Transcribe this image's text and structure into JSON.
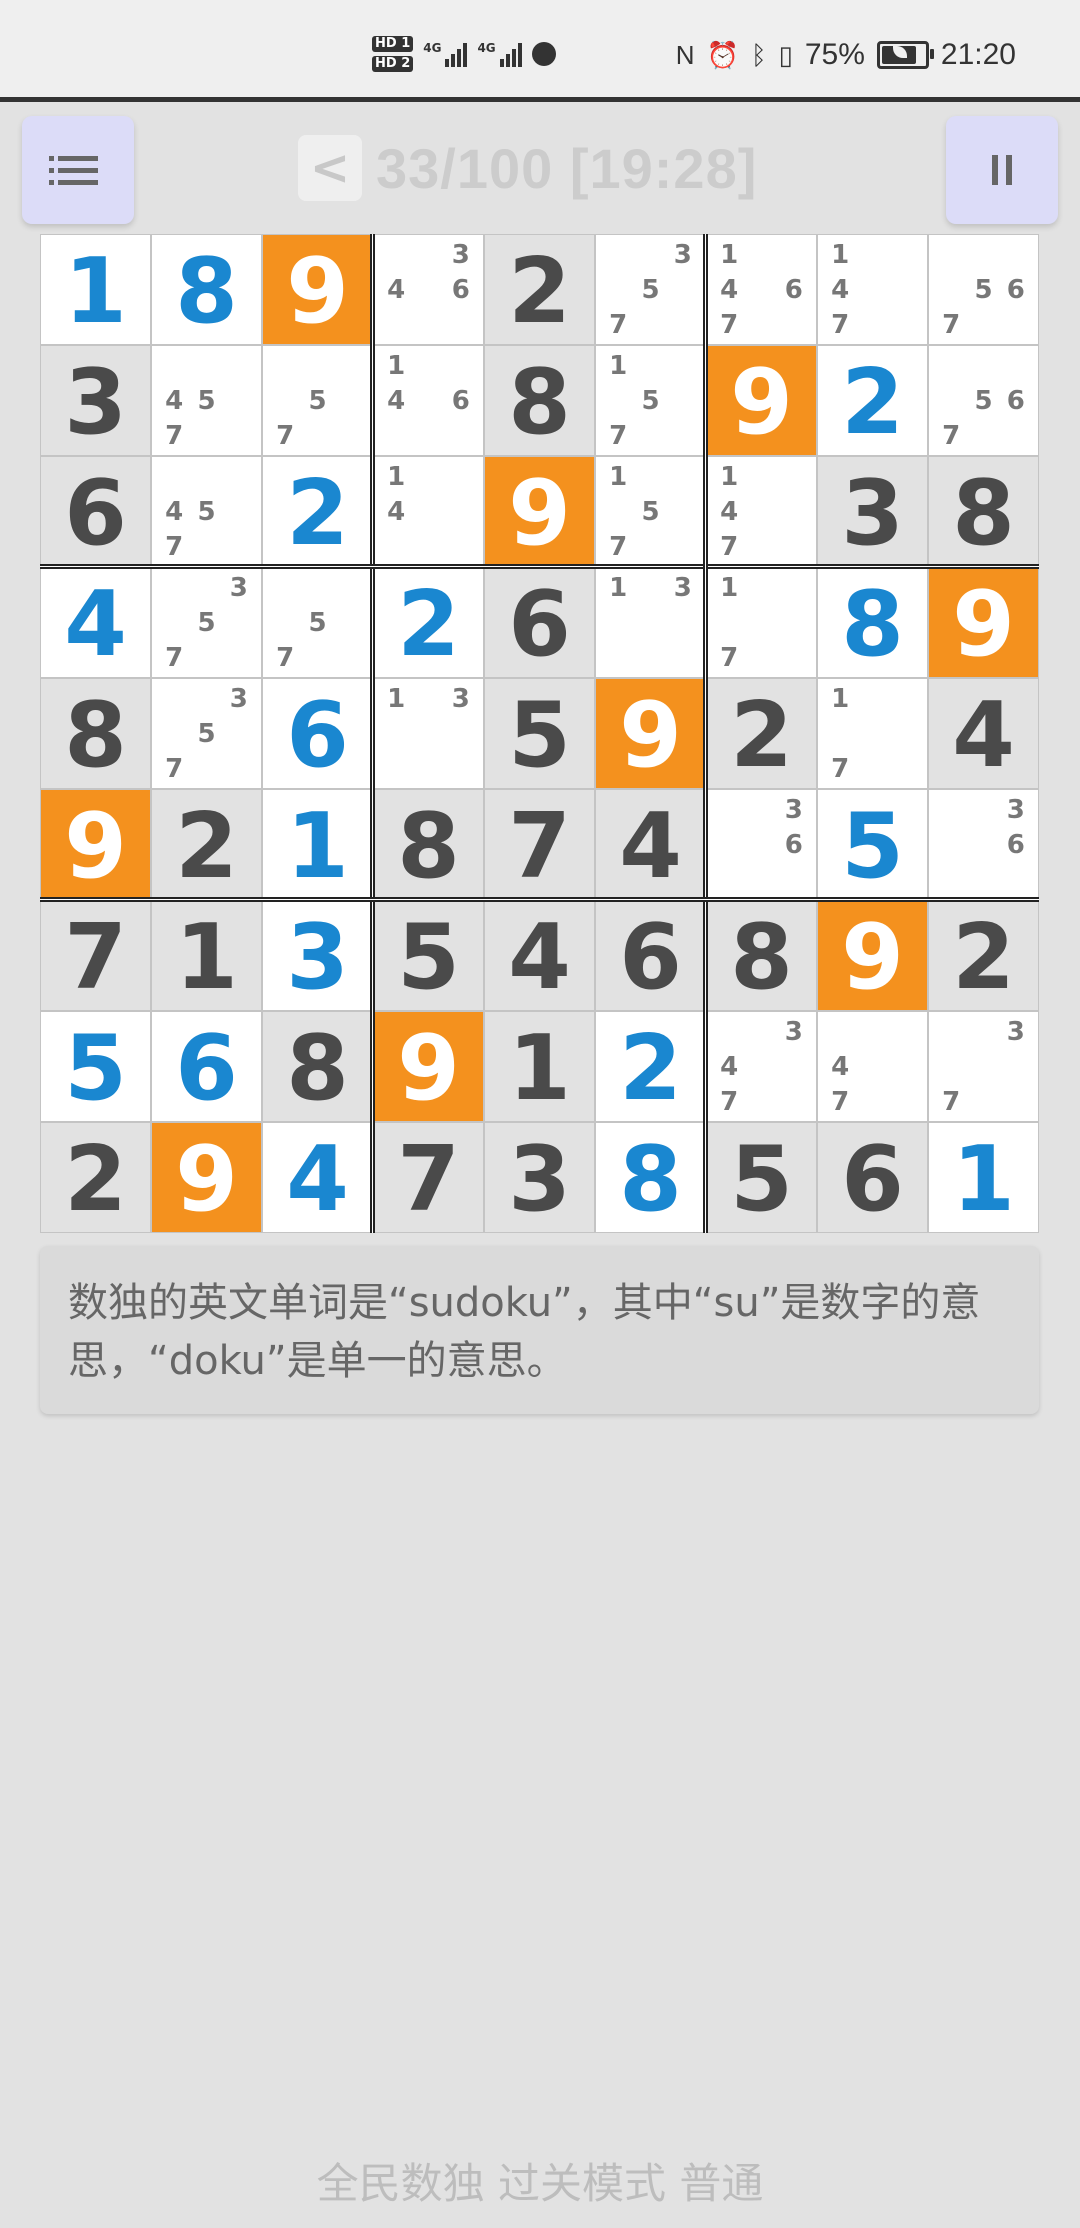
{
  "status_bar": {
    "hd1": "HD 1",
    "hd2": "HD 2",
    "net1": "4G",
    "net2": "4G",
    "battery_percent": "75%",
    "time": "21:20",
    "icons": [
      "nfc-icon",
      "alarm-icon",
      "bluetooth-icon",
      "vibrate-icon",
      "battery-icon"
    ]
  },
  "header": {
    "menu_icon": "list-icon",
    "back_label": "<",
    "progress": "33/100 [19:28]",
    "pause_icon": "pause-icon"
  },
  "board": {
    "highlight_digit": 9,
    "colors": {
      "given": "#4a4a4a",
      "user": "#1a87d0",
      "highlight_bg": "#f4911e",
      "given_bg": "#e2e2e2",
      "empty_bg": "#ffffff"
    },
    "rows": [
      [
        {
          "v": "1",
          "t": "user"
        },
        {
          "v": "8",
          "t": "user"
        },
        {
          "v": "9",
          "t": "user",
          "hl": true
        },
        {
          "n": [
            3,
            4,
            6
          ]
        },
        {
          "v": "2",
          "t": "given"
        },
        {
          "n": [
            3,
            5,
            7
          ]
        },
        {
          "n": [
            1,
            4,
            6,
            7
          ]
        },
        {
          "n": [
            1,
            4,
            7
          ]
        },
        {
          "n": [
            5,
            6,
            7
          ]
        }
      ],
      [
        {
          "v": "3",
          "t": "given"
        },
        {
          "n": [
            4,
            5,
            7
          ]
        },
        {
          "n": [
            5,
            7
          ]
        },
        {
          "n": [
            1,
            4,
            6
          ]
        },
        {
          "v": "8",
          "t": "given"
        },
        {
          "n": [
            1,
            5,
            7
          ]
        },
        {
          "v": "9",
          "t": "given",
          "hl": true
        },
        {
          "v": "2",
          "t": "user"
        },
        {
          "n": [
            5,
            6,
            7
          ]
        }
      ],
      [
        {
          "v": "6",
          "t": "given"
        },
        {
          "n": [
            4,
            5,
            7
          ]
        },
        {
          "v": "2",
          "t": "user"
        },
        {
          "n": [
            1,
            4
          ]
        },
        {
          "v": "9",
          "t": "given",
          "hl": true
        },
        {
          "n": [
            1,
            5,
            7
          ]
        },
        {
          "n": [
            1,
            4,
            7
          ]
        },
        {
          "v": "3",
          "t": "given"
        },
        {
          "v": "8",
          "t": "given"
        }
      ],
      [
        {
          "v": "4",
          "t": "user"
        },
        {
          "n": [
            3,
            5,
            7
          ]
        },
        {
          "n": [
            5,
            7
          ]
        },
        {
          "v": "2",
          "t": "user"
        },
        {
          "v": "6",
          "t": "given"
        },
        {
          "n": [
            1,
            3
          ]
        },
        {
          "n": [
            1,
            7
          ]
        },
        {
          "v": "8",
          "t": "user"
        },
        {
          "v": "9",
          "t": "given",
          "hl": true
        }
      ],
      [
        {
          "v": "8",
          "t": "given"
        },
        {
          "n": [
            3,
            5,
            7
          ]
        },
        {
          "v": "6",
          "t": "user"
        },
        {
          "n": [
            1,
            3
          ]
        },
        {
          "v": "5",
          "t": "given"
        },
        {
          "v": "9",
          "t": "given",
          "hl": true
        },
        {
          "v": "2",
          "t": "given"
        },
        {
          "n": [
            1,
            7
          ]
        },
        {
          "v": "4",
          "t": "given"
        }
      ],
      [
        {
          "v": "9",
          "t": "given",
          "hl": true
        },
        {
          "v": "2",
          "t": "given"
        },
        {
          "v": "1",
          "t": "user"
        },
        {
          "v": "8",
          "t": "given"
        },
        {
          "v": "7",
          "t": "given"
        },
        {
          "v": "4",
          "t": "given"
        },
        {
          "n": [
            3,
            6
          ]
        },
        {
          "v": "5",
          "t": "user"
        },
        {
          "n": [
            3,
            6
          ]
        }
      ],
      [
        {
          "v": "7",
          "t": "given"
        },
        {
          "v": "1",
          "t": "given"
        },
        {
          "v": "3",
          "t": "user"
        },
        {
          "v": "5",
          "t": "given"
        },
        {
          "v": "4",
          "t": "given"
        },
        {
          "v": "6",
          "t": "given"
        },
        {
          "v": "8",
          "t": "given"
        },
        {
          "v": "9",
          "t": "given",
          "hl": true
        },
        {
          "v": "2",
          "t": "given"
        }
      ],
      [
        {
          "v": "5",
          "t": "user"
        },
        {
          "v": "6",
          "t": "user"
        },
        {
          "v": "8",
          "t": "given"
        },
        {
          "v": "9",
          "t": "given",
          "hl": true
        },
        {
          "v": "1",
          "t": "given"
        },
        {
          "v": "2",
          "t": "user"
        },
        {
          "n": [
            3,
            4,
            7
          ]
        },
        {
          "n": [
            4,
            7
          ]
        },
        {
          "n": [
            3,
            7
          ]
        }
      ],
      [
        {
          "v": "2",
          "t": "given"
        },
        {
          "v": "9",
          "t": "given",
          "hl": true
        },
        {
          "v": "4",
          "t": "user"
        },
        {
          "v": "7",
          "t": "given"
        },
        {
          "v": "3",
          "t": "given"
        },
        {
          "v": "8",
          "t": "user"
        },
        {
          "v": "5",
          "t": "given"
        },
        {
          "v": "6",
          "t": "given"
        },
        {
          "v": "1",
          "t": "user"
        }
      ]
    ]
  },
  "tip": {
    "text": "数独的英文单词是“sudoku”，其中“su”是数字的意思，“doku”是单一的意思。"
  },
  "footer": {
    "text": "全民数独 过关模式 普通"
  }
}
